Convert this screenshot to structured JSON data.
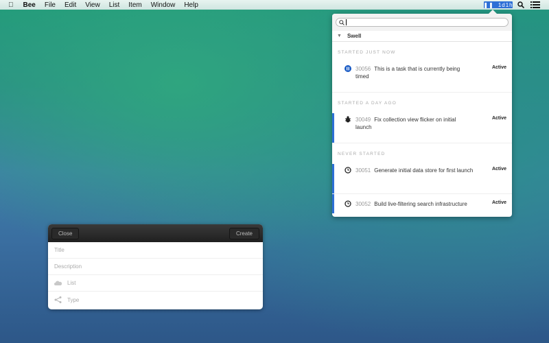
{
  "menubar": {
    "app": "Bee",
    "items": [
      "File",
      "Edit",
      "View",
      "List",
      "Item",
      "Window",
      "Help"
    ],
    "timer": "1d1h"
  },
  "popover": {
    "search_value": "",
    "group": "Swell",
    "sections": [
      {
        "title": "STARTED JUST NOW",
        "items": [
          {
            "id": "30056",
            "title": "This is a task that is currently being timed",
            "status": "Active",
            "icon": "pause-icon"
          }
        ]
      },
      {
        "title": "STARTED A DAY AGO",
        "items": [
          {
            "id": "30049",
            "title": "Fix collection view flicker on initial launch",
            "status": "Active",
            "icon": "bug-icon"
          }
        ]
      },
      {
        "title": "NEVER STARTED",
        "items": [
          {
            "id": "30051",
            "title": "Generate initial data store for first launch",
            "status": "Active",
            "icon": "clock-icon"
          },
          {
            "id": "30052",
            "title": "Build live-filtering search infrastructure",
            "status": "Active",
            "icon": "clock-icon"
          }
        ]
      }
    ]
  },
  "form": {
    "close": "Close",
    "create": "Create",
    "title_placeholder": "Title",
    "description_placeholder": "Description",
    "list_label": "List",
    "type_label": "Type"
  },
  "colors": {
    "accent": "#2d6fd6"
  }
}
